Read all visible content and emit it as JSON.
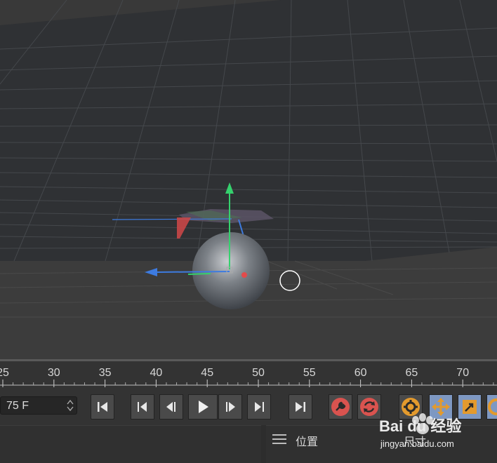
{
  "timeline": {
    "ticks": [
      "25",
      "30",
      "35",
      "40",
      "45",
      "50",
      "55",
      "60",
      "65",
      "70"
    ]
  },
  "transport": {
    "frame_value": "75 F"
  },
  "attributes": {
    "panel_title": "位置",
    "panel_title_2": "尺寸"
  },
  "watermark": {
    "brand": "Bai du 经验",
    "url": "jingyan.baidu.com"
  },
  "colors": {
    "record_button": "#d9534f",
    "axis_y": "#35d16d",
    "axis_x": "#3d7be0",
    "axis_z": "#e24b4b",
    "tool_orange": "#e39a2d",
    "selected_tool": "#7e98c2"
  },
  "icons": {
    "go_start": "go-to-start-icon",
    "prev_key": "previous-key-icon",
    "prev_frame": "previous-frame-icon",
    "play": "play-icon",
    "next_frame": "next-frame-icon",
    "next_key": "next-key-icon",
    "go_end": "go-to-end-icon",
    "record": "record-keys-icon",
    "autokey": "autokey-icon",
    "keyframe_settings": "keyframe-settings-icon",
    "move": "move-tool-icon",
    "scale": "scale-tool-icon"
  }
}
